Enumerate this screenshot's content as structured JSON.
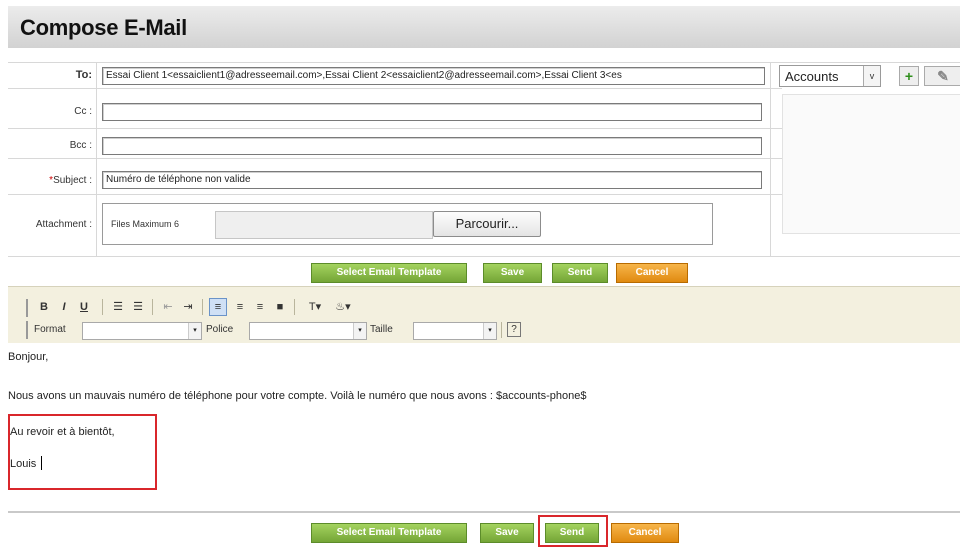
{
  "title": "Compose E-Mail",
  "fields": {
    "to_label": "To:",
    "to_value": "Essai Client 1<essaiclient1@adresseemail.com>,Essai Client 2<essaiclient2@adresseemail.com>,Essai Client 3<es",
    "cc_label": "Cc :",
    "cc_value": "",
    "bcc_label": "Bcc :",
    "bcc_value": "",
    "subject_required": "*",
    "subject_label": "Subject :",
    "subject_value": "Numéro de téléphone non valide",
    "attachment_label": "Attachment :",
    "files_maximum": "Files Maximum 6",
    "browse_label": "Parcourir..."
  },
  "accounts_select": {
    "value": "Accounts",
    "arrow": "v"
  },
  "actions": {
    "select_template": "Select Email Template",
    "save": "Save",
    "send": "Send",
    "cancel": "Cancel"
  },
  "editor": {
    "format_label": "Format",
    "police_label": "Police",
    "taille_label": "Taille",
    "help_icon": "?"
  },
  "message": {
    "line1": "Bonjour,",
    "line2": "Nous avons un mauvais numéro de téléphone pour votre compte. Voilà le numéro que nous avons : $accounts-phone$",
    "line3": "Au revoir et à bientôt,",
    "line4": "Louis"
  },
  "icons": {
    "add": "plus-icon",
    "clear": "eraser-icon"
  },
  "colors": {
    "green_button": "#74a536",
    "orange_button": "#e08a10",
    "highlight": "#d9262b",
    "toolbar_bg": "#f3f0df"
  }
}
